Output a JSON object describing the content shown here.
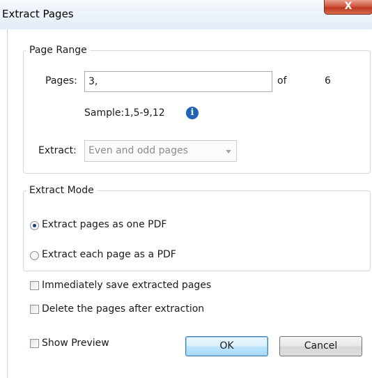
{
  "window": {
    "title": "Extract Pages",
    "close_glyph": "X"
  },
  "page_range": {
    "legend": "Page Range",
    "pages_label": "Pages:",
    "pages_value": "3,",
    "of_label": "of",
    "total_pages": "6",
    "sample_text": "Sample:1,5-9,12",
    "info_icon": "info-icon",
    "extract_label": "Extract:",
    "extract_selected": "Even and odd pages"
  },
  "extract_mode": {
    "legend": "Extract Mode",
    "options": [
      {
        "label": "Extract pages as one PDF",
        "checked": true
      },
      {
        "label": "Extract each page as a PDF",
        "checked": false
      }
    ]
  },
  "checkboxes": {
    "save_immediately": "Immediately save extracted pages",
    "delete_after": "Delete the pages after extraction",
    "show_preview": "Show Preview"
  },
  "buttons": {
    "ok": "OK",
    "cancel": "Cancel"
  },
  "colors": {
    "info_icon": "#1e63b8",
    "close_button": "#c0391f",
    "default_button_border": "#3c7fb1"
  }
}
